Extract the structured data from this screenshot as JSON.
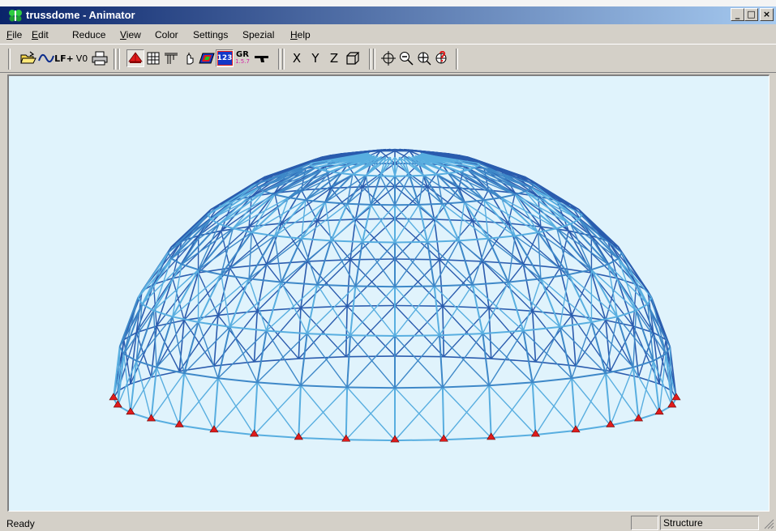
{
  "window": {
    "title": "trussdome - Animator",
    "controls": {
      "minimize": "_",
      "maximize": "□",
      "close": "×"
    }
  },
  "menubar": {
    "items": [
      {
        "label": "File",
        "underline": "F",
        "rest": "ile"
      },
      {
        "label": "Edit",
        "underline": "E",
        "rest": "dit"
      },
      {
        "label": "Reduce",
        "underline": "",
        "rest": "Reduce"
      },
      {
        "label": "View",
        "underline": "V",
        "rest": "iew"
      },
      {
        "label": "Color",
        "underline": "",
        "rest": "Color"
      },
      {
        "label": "Settings",
        "underline": "",
        "rest": "Settings"
      },
      {
        "label": "Spezial",
        "underline": "",
        "rest": "Spezial"
      },
      {
        "label": "Help",
        "underline": "H",
        "rest": "elp"
      }
    ]
  },
  "toolbar": {
    "lf_label": "LF+",
    "v0_label": "V0",
    "num_label": "123",
    "gr_label": "GR",
    "gr_sub": "1.5.7",
    "x_label": "X",
    "y_label": "Y",
    "z_label": "Z"
  },
  "structure": {
    "name": "trussdome",
    "lines": 7,
    "supports": 18,
    "icons": [
      "open-folder-icon",
      "wave-icon",
      "printer-icon",
      "support-icon",
      "grid-icon",
      "beam-icon",
      "hand-icon",
      "color-plane-icon",
      "number-icon",
      "gr-icon",
      "gun-icon",
      "cube-icon",
      "target-icon",
      "zoom-out-icon",
      "zoom-in-icon",
      "zoom-help-icon"
    ],
    "colors": {
      "strut_light": "#58aee0",
      "strut_mid": "#3e88c8",
      "strut_dark": "#2a5cae",
      "support": "#e11b1b",
      "background": "#e0f3fc"
    }
  },
  "statusbar": {
    "text": "Ready",
    "pane_2": "Structure"
  }
}
